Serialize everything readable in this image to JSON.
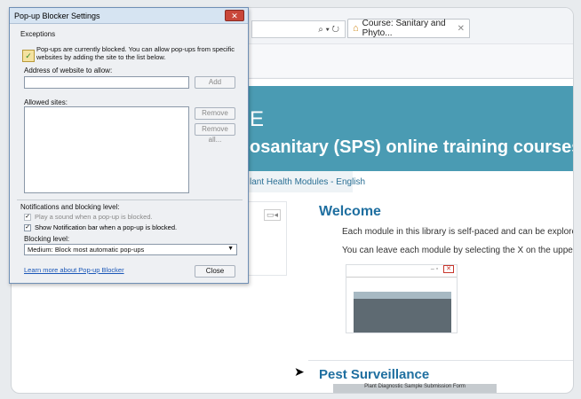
{
  "browser": {
    "addr_icons": "⌕ ▾ ↻",
    "tab": {
      "icon": "home-icon",
      "title": "Course: Sanitary and Phyto...",
      "close": "✕"
    }
  },
  "page": {
    "banner_logo": "E",
    "banner_title": "osanitary (SPS) online training courses - En",
    "breadcrumb": "lant Health Modules - English",
    "welcome_heading": "Welcome",
    "para1": "Each module in this library is self-paced and can be explored in any ord",
    "para2": "You can leave each module by selecting the X on the upper right (if on a",
    "pest_heading": "Pest Surveillance",
    "pest_image_caption": "Plant Diagnostic Sample Submission Form"
  },
  "dialog": {
    "title": "Pop-up Blocker Settings",
    "close_label": "✕",
    "exceptions_label": "Exceptions",
    "info_text": "Pop-ups are currently blocked.  You can allow pop-ups from specific websites by adding the site to the list below.",
    "address_label": "Address of website to allow:",
    "address_value": "",
    "add_button": "Add",
    "allowed_label": "Allowed sites:",
    "remove_button": "Remove",
    "remove_all_button": "Remove all...",
    "notifications_label": "Notifications and blocking level:",
    "play_sound_label": "Play a sound when a pop-up is blocked.",
    "play_sound_checked": true,
    "show_bar_label": "Show Notification bar when a pop-up is blocked.",
    "show_bar_checked": true,
    "blocking_level_label": "Blocking level:",
    "blocking_level_value": "Medium: Block most automatic pop-ups",
    "learn_more_link": "Learn more about Pop-up Blocker",
    "close_button": "Close"
  }
}
